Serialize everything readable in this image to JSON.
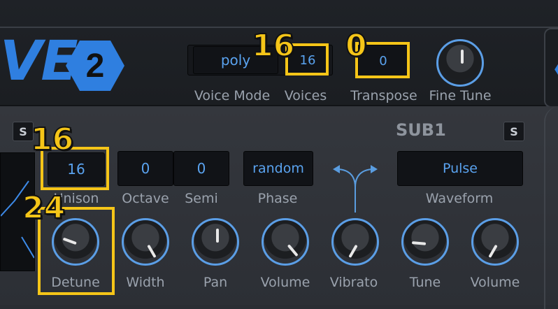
{
  "header": {
    "logo_text": "VE",
    "logo_badge": "2",
    "voice_mode": {
      "value": "poly",
      "label": "Voice Mode"
    },
    "voices": {
      "value": "16",
      "label": "Voices"
    },
    "transpose": {
      "value": "0",
      "label": "Transpose"
    },
    "fine_tune": {
      "label": "Fine Tune"
    }
  },
  "osc": {
    "solo_label": "S",
    "unison": {
      "value": "16",
      "label": "Unison"
    },
    "octave": {
      "value": "0",
      "label": "Octave"
    },
    "semi": {
      "value": "0",
      "label": "Semi"
    },
    "phase": {
      "value": "random",
      "label": "Phase"
    },
    "knobs": {
      "detune": "Detune",
      "width": "Width",
      "pan": "Pan",
      "volume": "Volume",
      "vibrato": "Vibrato"
    }
  },
  "sub": {
    "title": "SUB1",
    "solo_label": "S",
    "waveform": {
      "value": "Pulse",
      "label": "Waveform"
    },
    "knobs": {
      "tune": "Tune",
      "volume": "Volume"
    }
  },
  "annotations": {
    "voices_marker": "16",
    "transpose_marker": "0",
    "unison_marker": "16",
    "detune_marker": "24"
  },
  "colors": {
    "accent": "#5aa3f0",
    "highlight": "#f5c518",
    "background": "#2a2d33"
  }
}
